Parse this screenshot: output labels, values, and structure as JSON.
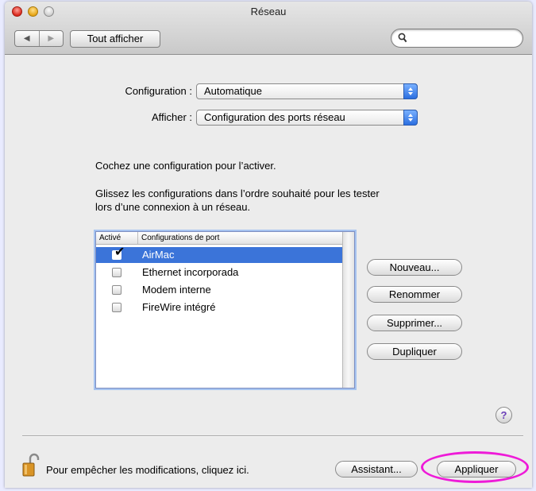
{
  "window": {
    "title": "Réseau"
  },
  "toolbar": {
    "back_icon": "◀",
    "forward_icon": "▶",
    "show_all_label": "Tout afficher",
    "search_placeholder": ""
  },
  "config": {
    "label": "Configuration :",
    "value": "Automatique"
  },
  "show": {
    "label": "Afficher :",
    "value": "Configuration des ports réseau"
  },
  "instructions": {
    "line1": "Cochez une configuration pour l’activer.",
    "line2a": "Glissez les configurations dans l’ordre souhaité pour les tester",
    "line2b": "lors d’une connexion à un réseau."
  },
  "table": {
    "columns": [
      "Activé",
      "Configurations de port"
    ],
    "rows": [
      {
        "name": "AirMac",
        "checked": true,
        "selected": true
      },
      {
        "name": "Ethernet incorporada",
        "checked": false,
        "selected": false
      },
      {
        "name": "Modem interne",
        "checked": false,
        "selected": false
      },
      {
        "name": "FireWire intégré",
        "checked": false,
        "selected": false
      }
    ]
  },
  "side_buttons": {
    "new": "Nouveau...",
    "rename": "Renommer",
    "delete": "Supprimer...",
    "duplicate": "Dupliquer"
  },
  "help": {
    "label": "?"
  },
  "footer": {
    "lock_text": "Pour empêcher les modifications, cliquez ici.",
    "assistant": "Assistant...",
    "apply": "Appliquer"
  },
  "colors": {
    "highlight": "#ee1bd8",
    "selection": "#3b74d9",
    "background": "#e9ebff"
  }
}
